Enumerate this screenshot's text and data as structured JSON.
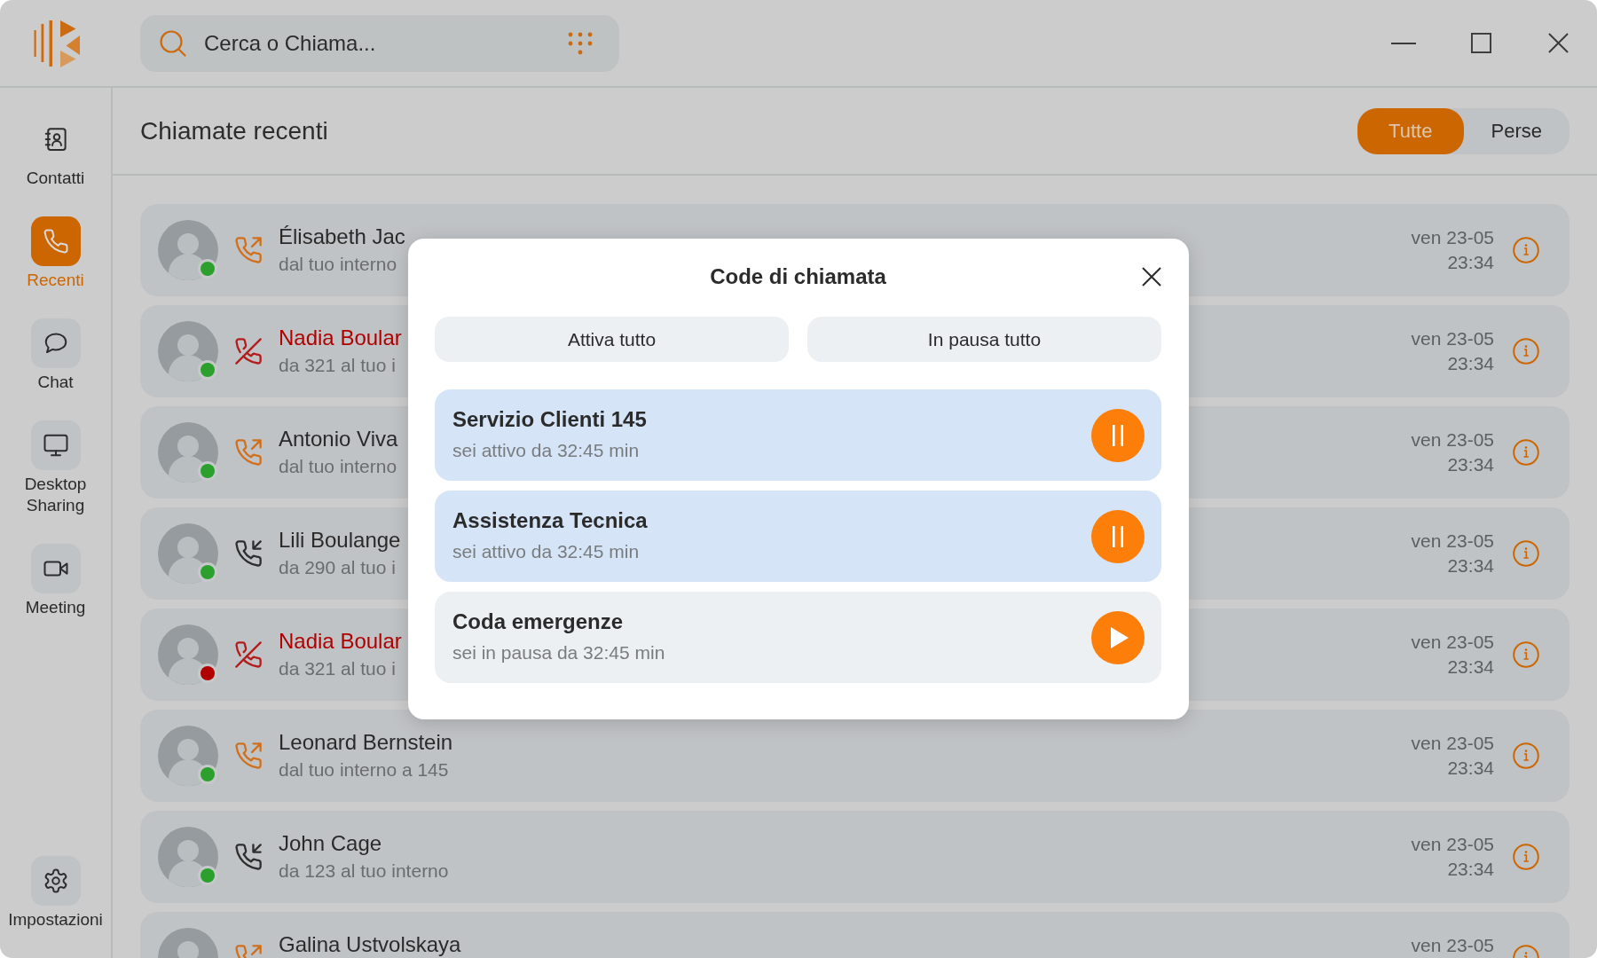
{
  "search": {
    "placeholder": "Cerca o Chiama..."
  },
  "sidebar": {
    "items": [
      {
        "label": "Contatti",
        "selected": false,
        "framed": false
      },
      {
        "label": "Recenti",
        "selected": true,
        "framed": true
      },
      {
        "label": "Chat",
        "selected": false,
        "framed": true
      },
      {
        "label": "Desktop Sharing",
        "selected": false,
        "framed": true
      },
      {
        "label": "Meeting",
        "selected": false,
        "framed": true
      }
    ],
    "settings": {
      "label": "Impostazioni",
      "selected": false,
      "framed": true
    }
  },
  "recent_calls": {
    "title": "Chiamate recenti",
    "filters": [
      {
        "label": "Tutte",
        "selected": true
      },
      {
        "label": "Perse",
        "selected": false
      }
    ],
    "rows": [
      {
        "name": "Élisabeth Jac",
        "detail": "dal tuo interno",
        "kind": "outgoing",
        "color": "#2ca02c",
        "date": "ven 23-05",
        "time": "23:34"
      },
      {
        "name": "Nadia Boular",
        "detail": "da 321 al tuo i",
        "kind": "missed",
        "color": "#2ca02c",
        "date": "ven 23-05",
        "time": "23:34"
      },
      {
        "name": "Antonio Viva",
        "detail": "dal tuo interno",
        "kind": "outgoing",
        "color": "#2ca02c",
        "date": "ven 23-05",
        "time": "23:34"
      },
      {
        "name": "Lili Boulange",
        "detail": "da 290 al tuo i",
        "kind": "incoming",
        "color": "#2ca02c",
        "date": "ven 23-05",
        "time": "23:34"
      },
      {
        "name": "Nadia Boular",
        "detail": "da 321 al tuo i",
        "kind": "missed",
        "color": "#b00000",
        "date": "ven 23-05",
        "time": "23:34"
      },
      {
        "name": "Leonard Bernstein",
        "detail": "dal tuo interno a 145",
        "kind": "outgoing",
        "color": "#2ca02c",
        "date": "ven 23-05",
        "time": "23:34"
      },
      {
        "name": "John Cage",
        "detail": "da 123 al tuo interno",
        "kind": "incoming",
        "color": "#2ca02c",
        "date": "ven 23-05",
        "time": "23:34"
      },
      {
        "name": "Galina Ustvolskaya",
        "kind": "outgoing",
        "date": "ven 23-05"
      }
    ]
  },
  "dialog": {
    "title": "Code di chiamata",
    "actions": [
      "Attiva tutto",
      "In pausa tutto"
    ],
    "queues": [
      {
        "name": "Servizio Clienti 145",
        "status": "sei attivo da 32:45 min",
        "active": true
      },
      {
        "name": "Assistenza Tecnica",
        "status": "sei attivo da 32:45 min",
        "active": true
      },
      {
        "name": "Coda emergenze",
        "status": "sei in pausa da 32:45 min",
        "active": false
      }
    ]
  }
}
